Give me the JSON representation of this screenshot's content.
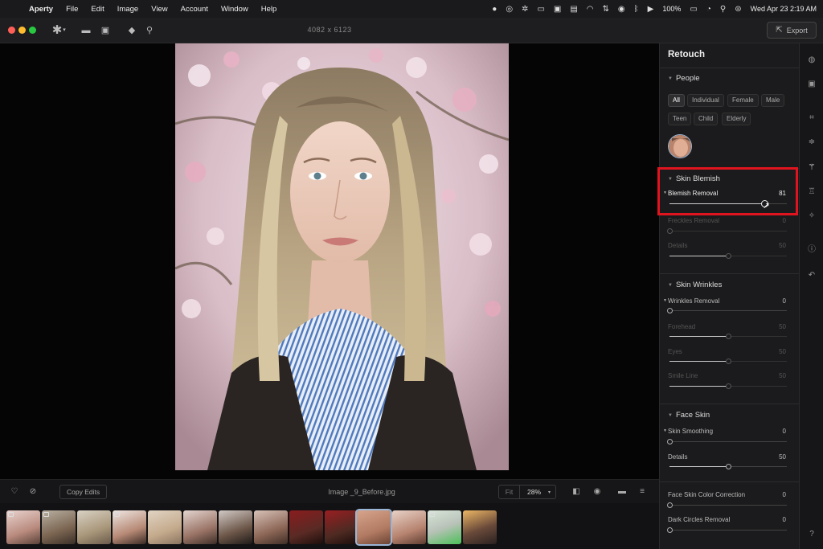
{
  "menubar": {
    "apple": "",
    "app_name": "Aperty",
    "menus": [
      "File",
      "Edit",
      "Image",
      "View",
      "Account",
      "Window",
      "Help"
    ],
    "battery": "100%",
    "datetime": "Wed Apr 23  2:19 AM"
  },
  "toolbar": {
    "image_dimensions": "4082 x 6123",
    "export_label": "Export"
  },
  "bottombar": {
    "copy_edits_label": "Copy Edits",
    "filename": "Image _9_Before.jpg",
    "fit_label": "Fit",
    "zoom_value": "28%"
  },
  "filmstrip": {
    "selected_index": 10,
    "count": 14
  },
  "panel": {
    "title": "Retouch",
    "people": {
      "title": "People",
      "chips_row1": [
        "All",
        "Individual",
        "Female",
        "Male"
      ],
      "chips_row2": [
        "Teen",
        "Child",
        "Elderly"
      ],
      "active_chip": "All"
    },
    "skin_blemish": {
      "title": "Skin Blemish",
      "sliders": [
        {
          "label": "Blemish Removal",
          "value": "81",
          "fraction": 0.81
        },
        {
          "label": "Freckles Removal",
          "value": "0",
          "fraction": 0
        },
        {
          "label": "Details",
          "value": "50",
          "fraction": 0.5
        }
      ]
    },
    "skin_wrinkles": {
      "title": "Skin Wrinkles",
      "sliders": [
        {
          "label": "Wrinkles Removal",
          "value": "0",
          "fraction": 0
        },
        {
          "label": "Forehead",
          "value": "50",
          "fraction": 0.5
        },
        {
          "label": "Eyes",
          "value": "50",
          "fraction": 0.5
        },
        {
          "label": "Smile Line",
          "value": "50",
          "fraction": 0.5
        }
      ]
    },
    "face_skin": {
      "title": "Face Skin",
      "sliders": [
        {
          "label": "Skin Smoothing",
          "value": "0",
          "fraction": 0
        },
        {
          "label": "Details",
          "value": "50",
          "fraction": 0.5
        },
        {
          "label": "Face Skin Color Correction",
          "value": "0",
          "fraction": 0
        },
        {
          "label": "Dark Circles Removal",
          "value": "0",
          "fraction": 0
        }
      ]
    }
  },
  "colors": {
    "highlight": "#e0141e",
    "selected_outline": "#9ab6d6"
  }
}
